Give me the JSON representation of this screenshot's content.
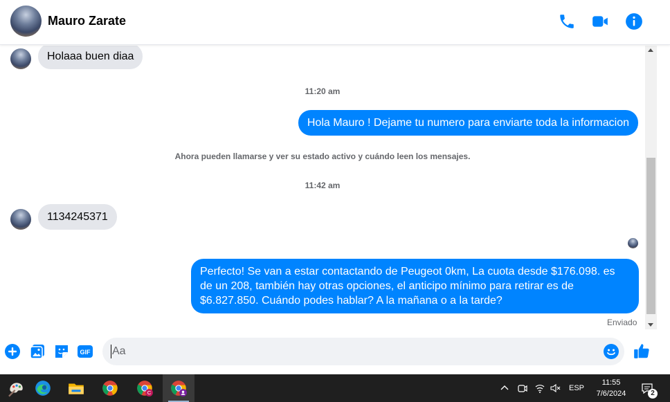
{
  "header": {
    "contact_name": "Mauro Zarate",
    "icons": [
      "phone-icon",
      "video-icon",
      "info-icon"
    ],
    "accent_color": "#0084ff"
  },
  "messages": [
    {
      "type": "incoming",
      "text": "Holaaa buen diaa"
    },
    {
      "type": "timestamp",
      "text": "11:20 am"
    },
    {
      "type": "outgoing",
      "text": "Hola Mauro ! Dejame tu numero para enviarte toda la informacion"
    },
    {
      "type": "system",
      "text": "Ahora pueden llamarse y ver su estado activo y cuándo leen los mensajes."
    },
    {
      "type": "timestamp",
      "text": "11:42 am"
    },
    {
      "type": "incoming",
      "text": "1134245371"
    },
    {
      "type": "outgoing",
      "lines": [
        "Perfecto!  Se van a estar contactando de Peugeot 0km, La cuota desde $176.098. es",
        "de un 208, también hay otras opciones, el anticipo mínimo para retirar es de",
        "$6.827.850. Cuándo podes hablar? A la mañana o a la tarde?"
      ]
    }
  ],
  "delivery_status": "Enviado",
  "composer": {
    "placeholder": "Aa",
    "icons": [
      "plus-icon",
      "photo-icon",
      "sticker-icon",
      "gif-icon",
      "emoji-icon",
      "thumbs-up-icon"
    ]
  },
  "taskbar": {
    "apps": [
      "paint-icon",
      "edge-icon",
      "file-explorer-icon",
      "chrome-icon",
      "chrome-profile-c-icon",
      "chrome-profile-active-icon"
    ],
    "language": "ESP",
    "time": "11:55",
    "date": "7/6/2024",
    "notification_count": "2"
  }
}
